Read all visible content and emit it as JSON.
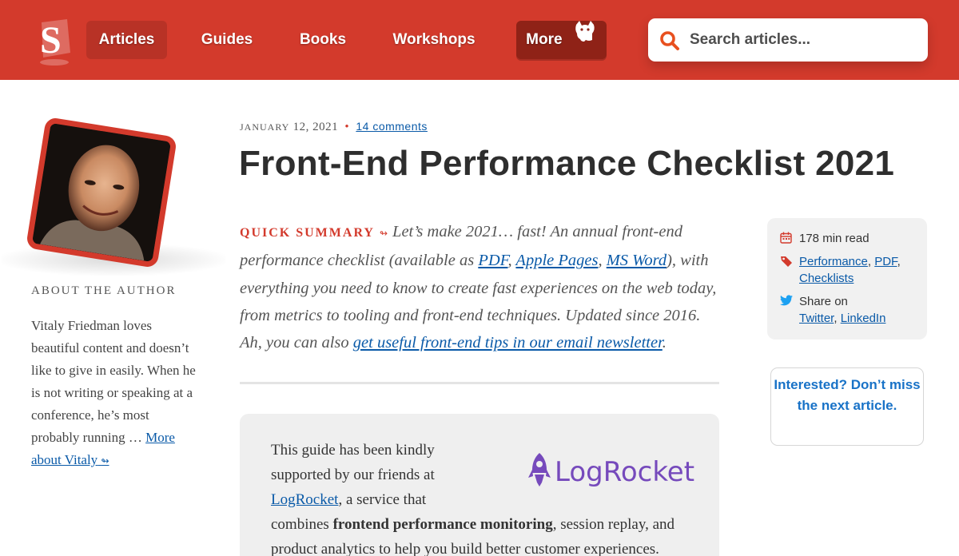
{
  "brand": {
    "accent": "#d33a2c",
    "link": "#0a5aa8",
    "logo_letter": "S"
  },
  "nav": {
    "items": [
      {
        "label": "Articles",
        "active": true
      },
      {
        "label": "Guides"
      },
      {
        "label": "Books"
      },
      {
        "label": "Workshops"
      },
      {
        "label": "More"
      }
    ]
  },
  "search": {
    "placeholder": "Search articles..."
  },
  "author": {
    "heading": "ABOUT THE AUTHOR",
    "bio": "Vitaly Friedman loves beautiful content and doesn’t like to give in easily. When he is not writing or speaking at a conference, he’s most probably running …",
    "more_link": "More about Vitaly",
    "more_arrow": "↬"
  },
  "article": {
    "date_month": "JANUARY",
    "date_rest": "12, 2021",
    "meta_sep": "•",
    "comments": "14 comments",
    "title": "Front-End Performance Checklist 2021",
    "summary": {
      "label": "QUICK SUMMARY",
      "arrow": "↬",
      "text1": "Let’s make 2021… fast! An annual front-end performance checklist (available as ",
      "link_pdf": "PDF",
      "sep1": ", ",
      "link_pages": "Apple Pages",
      "sep2": ", ",
      "link_word": "MS Word",
      "text2": "), with everything you need to know to create fast experiences on the web today, from metrics to tooling and front-end techniques. Updated since 2016. Ah, you can also ",
      "link_newsletter": "get useful front-end tips in our email newsletter",
      "text3": "."
    }
  },
  "sponsor": {
    "text1": "This guide has been kindly supported by our friends at ",
    "link": "LogRocket",
    "text2": ", a service that combines ",
    "bold": "frontend performance monitoring",
    "text3": ", session replay, and product analytics to help you build better customer experiences.",
    "logo_name": "LogRocket",
    "logo_color": "#764abc"
  },
  "info": {
    "read_time": "178 min read",
    "tag1": "Performance",
    "tag_sep1": ", ",
    "tag2": "PDF",
    "tag_sep2": ",",
    "tag3": "Checklists",
    "share_label": "Share on",
    "share_twitter": "Twitter",
    "share_sep": ", ",
    "share_linkedin": "LinkedIn"
  },
  "newsletter_box": {
    "text": "Interested? Don’t miss the next article."
  },
  "icons": [
    "search-icon",
    "calendar-icon",
    "tag-icon",
    "twitter-icon",
    "cat-icon",
    "rocket-icon"
  ]
}
